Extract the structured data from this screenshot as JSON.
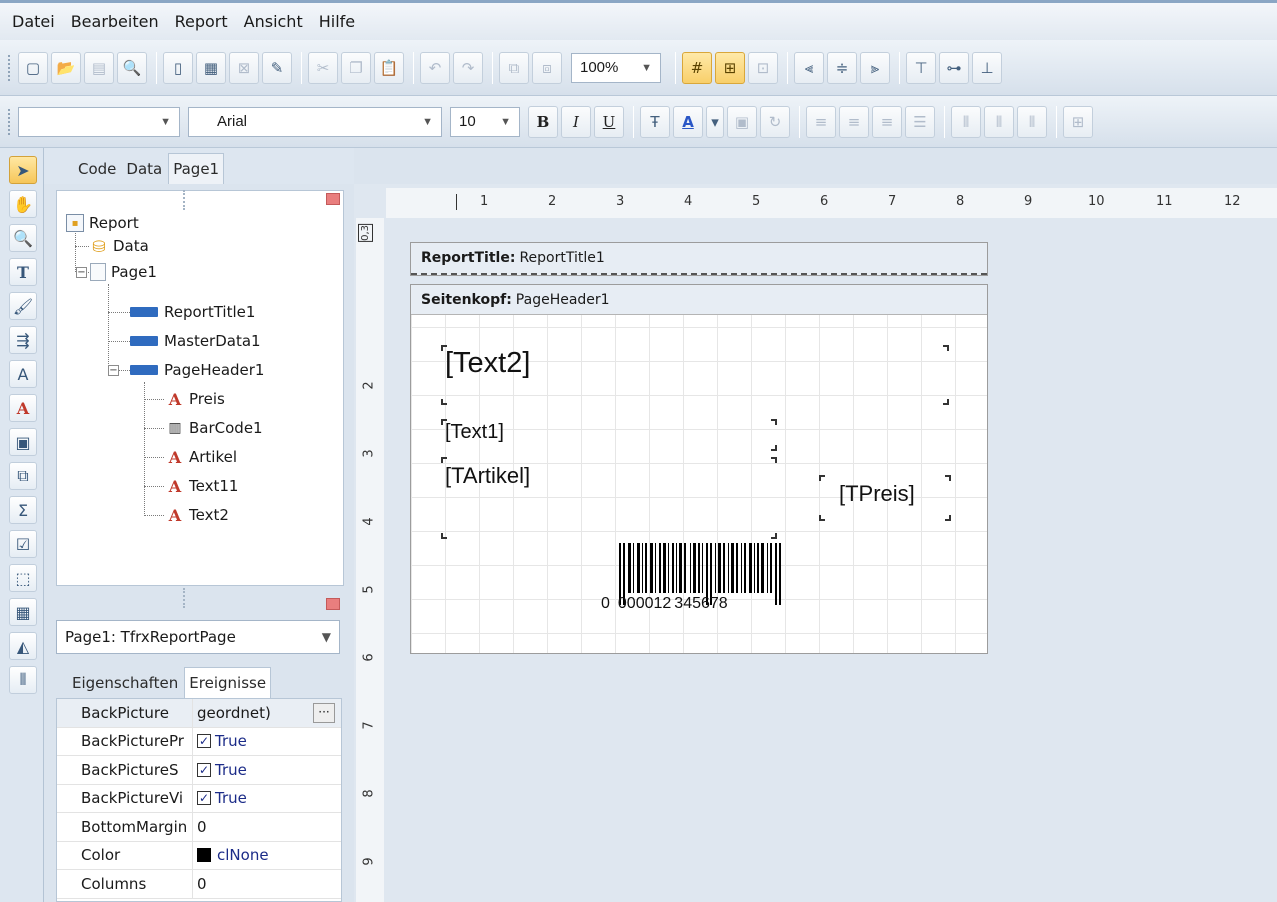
{
  "menu": [
    "Datei",
    "Bearbeiten",
    "Report",
    "Ansicht",
    "Hilfe"
  ],
  "toolbar1": {
    "zoom": "100%",
    "icons": [
      "new-icon",
      "open-icon",
      "save-icon",
      "preview-icon",
      "new-page-icon",
      "new-dialog-icon",
      "delete-page-icon",
      "page-settings-icon",
      "cut-icon",
      "copy-icon",
      "paste-icon",
      "undo-icon",
      "redo-icon",
      "group-icon",
      "ungroup-icon",
      "show-grid-icon",
      "align-to-grid-icon",
      "fit-grid-icon",
      "align-left-icon",
      "align-center-icon",
      "align-right-icon",
      "align-top-icon",
      "align-middle-icon",
      "align-bottom-icon"
    ]
  },
  "toolbar2": {
    "style_value": "",
    "font_name": "Arial",
    "font_size": "10",
    "bold": "B",
    "italic": "I",
    "underline": "U"
  },
  "left_tabs": [
    "Code",
    "Data",
    "Page1"
  ],
  "tree": [
    {
      "label": "Report",
      "icon": "report-icon"
    },
    {
      "label": "Data",
      "icon": "database-icon"
    },
    {
      "label": "Page1",
      "icon": "page-icon"
    },
    {
      "label": "ReportTitle1",
      "icon": "band-icon"
    },
    {
      "label": "MasterData1",
      "icon": "band-icon"
    },
    {
      "label": "PageHeader1",
      "icon": "band-icon"
    },
    {
      "label": "Preis",
      "icon": "text-object-icon"
    },
    {
      "label": "BarCode1",
      "icon": "barcode-icon"
    },
    {
      "label": "Artikel",
      "icon": "text-object-icon"
    },
    {
      "label": "Text11",
      "icon": "text-object-icon"
    },
    {
      "label": "Text2",
      "icon": "text-object-icon"
    }
  ],
  "object_selector": "Page1: TfrxReportPage",
  "inspector_tabs": [
    "Eigenschaften",
    "Ereignisse"
  ],
  "properties": [
    {
      "name": "BackPicture",
      "value": "geordnet)",
      "kind": "ellipsis"
    },
    {
      "name": "BackPicturePr",
      "value": "True",
      "kind": "check"
    },
    {
      "name": "BackPictureS",
      "value": "True",
      "kind": "check"
    },
    {
      "name": "BackPictureVi",
      "value": "True",
      "kind": "check"
    },
    {
      "name": "BottomMargin",
      "value": "0",
      "kind": "text"
    },
    {
      "name": "Color",
      "value": "clNone",
      "kind": "color"
    },
    {
      "name": "Columns",
      "value": "0",
      "kind": "text"
    }
  ],
  "ruler": {
    "h_numbers": [
      "1",
      "2",
      "3",
      "4",
      "5",
      "6",
      "7",
      "8",
      "9",
      "10",
      "11",
      "12"
    ],
    "v_numbers": [
      "2",
      "3",
      "4",
      "5",
      "6",
      "7",
      "8",
      "9"
    ],
    "v_top_label": "0,3"
  },
  "designer": {
    "band1_type": "ReportTitle:",
    "band1_name": "ReportTitle1",
    "band2_type": "Seitenkopf:",
    "band2_name": "PageHeader1",
    "text2": "[Text2]",
    "text1": "[Text1]",
    "tartikel": "[TArtikel]",
    "tpreis": "[TPreis]",
    "barcode_value": "0000012345678",
    "barcode_first": "0",
    "barcode_group1": "000012",
    "barcode_group2": "345678"
  },
  "colors": {
    "accent_active": "#f6c659",
    "red_close": "#e97e7e"
  }
}
